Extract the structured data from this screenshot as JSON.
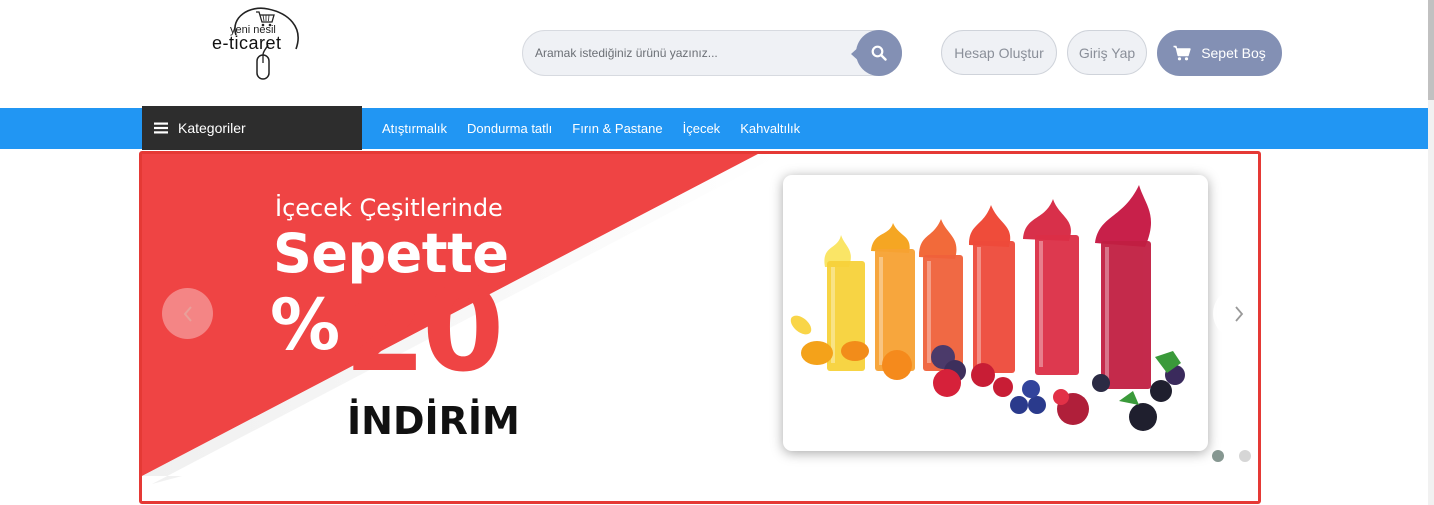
{
  "logo": {
    "small_text": "yeni nesil",
    "big_text": "e-ticaret",
    "icon": "mouse-cart-logo"
  },
  "search": {
    "placeholder": "Aramak istediğiniz ürünü yazınız...",
    "value": "",
    "button_icon": "search-icon"
  },
  "header": {
    "register_label": "Hesap Oluştur",
    "login_label": "Giriş Yap",
    "cart_label": "Sepet Boş",
    "cart_icon": "cart-icon"
  },
  "nav": {
    "categories_label": "Kategoriler",
    "categories_icon": "menu-icon",
    "links": [
      "Atıştırmalık",
      "Dondurma tatlı",
      "Fırın & Pastane",
      "İçecek",
      "Kahvaltılık"
    ]
  },
  "slider": {
    "promo_line1": "İçecek Çeşitlerinde",
    "promo_line2": "Sepette",
    "promo_percent": "%",
    "promo_number": "20",
    "promo_line4": "İNDİRİM",
    "prev_icon": "chevron-left-icon",
    "next_icon": "chevron-right-icon",
    "slide_count": 2,
    "active_slide": 1
  },
  "colors": {
    "nav_blue": "#2196f3",
    "promo_red": "#ef4444",
    "slider_border": "#e53935",
    "button_slate": "#8390b4",
    "categories_dark": "#2d2d2d"
  }
}
